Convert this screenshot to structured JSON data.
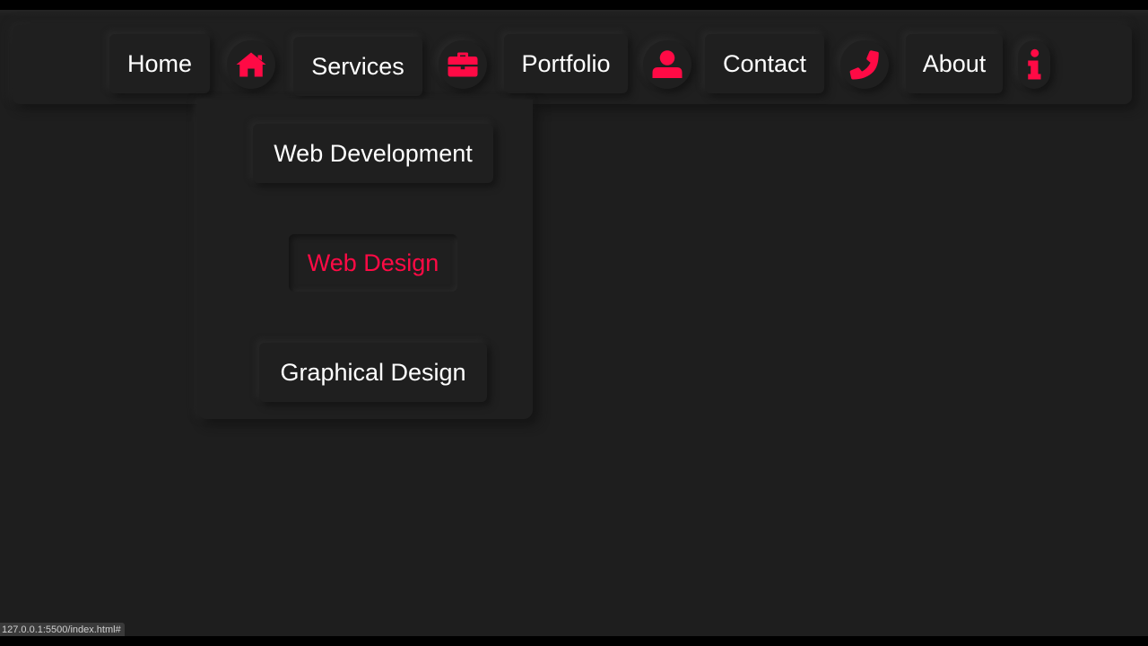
{
  "nav": {
    "home_label": "Home",
    "services_label": "Services",
    "portfolio_label": "Portfolio",
    "contact_label": "Contact",
    "about_label": "About",
    "icons": [
      "home-icon",
      "briefcase-icon",
      "user-icon",
      "phone-icon",
      "info-icon"
    ],
    "accent_color": "#ff0a45"
  },
  "dropdown": {
    "items": [
      {
        "label": "Web Development",
        "active": false
      },
      {
        "label": "Web Design",
        "active": true
      },
      {
        "label": "Graphical Design",
        "active": false
      }
    ]
  },
  "status": {
    "url": "127.0.0.1:5500/index.html#"
  },
  "theme": {
    "background": "#1e1e1e",
    "text": "#ffffff"
  }
}
